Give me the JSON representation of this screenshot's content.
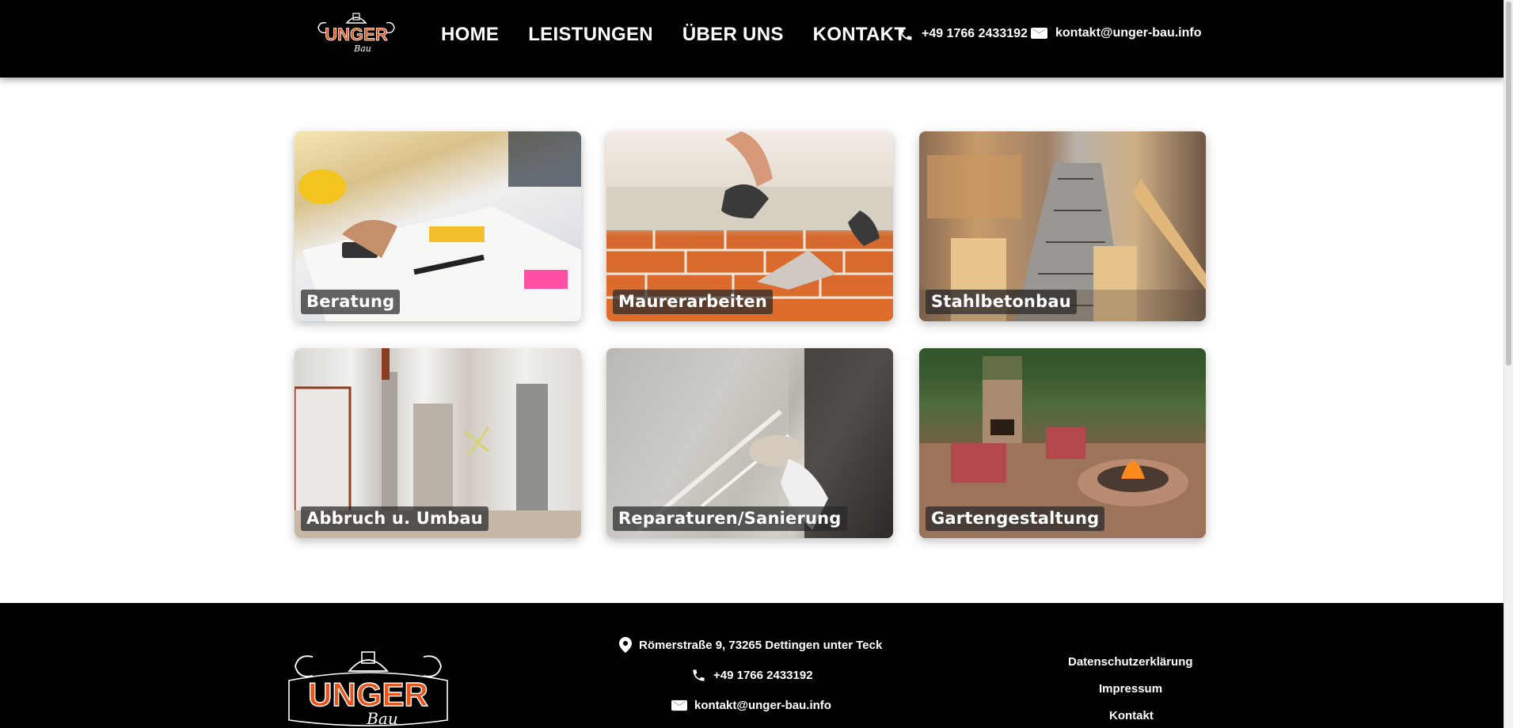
{
  "brand": {
    "logo_text": "UNGER",
    "logo_subtext": "Bau",
    "colors": {
      "brand_orange": "#e8541c",
      "header_bg": "#000000",
      "footer_bg": "#000000"
    }
  },
  "nav": {
    "items": [
      {
        "label": "HOME"
      },
      {
        "label": "LEISTUNGEN"
      },
      {
        "label": "ÜBER UNS"
      },
      {
        "label": "KONTAKT"
      }
    ]
  },
  "header_contact": {
    "phone": "+49 1766 2433192",
    "email": "kontakt@unger-bau.info",
    "phone_icon": "phone-icon",
    "mail_icon": "mail-icon"
  },
  "services": [
    {
      "label": "Beratung"
    },
    {
      "label": "Maurerarbeiten"
    },
    {
      "label": "Stahlbetonbau"
    },
    {
      "label": "Abbruch u. Umbau"
    },
    {
      "label": "Reparaturen/Sanierung"
    },
    {
      "label": "Gartengestaltung"
    }
  ],
  "footer": {
    "address": "Römerstraße 9, 73265 Dettingen unter Teck",
    "phone": "+49 1766 2433192",
    "email": "kontakt@unger-bau.info",
    "links": [
      {
        "label": "Datenschutzerklärung"
      },
      {
        "label": "Impressum"
      },
      {
        "label": "Kontakt"
      }
    ],
    "location_icon": "location-pin-icon"
  }
}
